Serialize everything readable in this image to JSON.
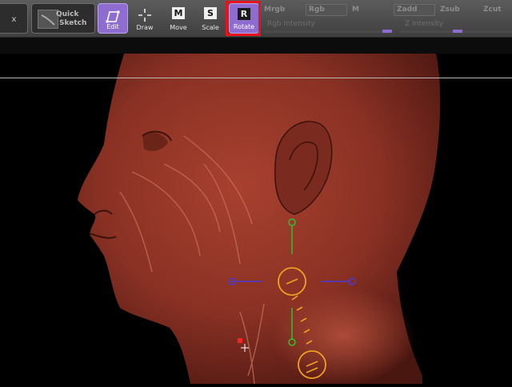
{
  "toolbar": {
    "close_label": "x",
    "quick_sketch": {
      "line1": "Quick",
      "line2": "Sketch"
    },
    "edit_label": "Edit",
    "draw_label": "Draw",
    "move_label": "Move",
    "move_letter": "M",
    "scale_label": "Scale",
    "scale_letter": "S",
    "rotate_label": "Rotate",
    "rotate_letter": "R"
  },
  "right_panel": {
    "mrgb_label": "Mrgb",
    "rgb_label": "Rgb",
    "m_label": "M",
    "zadd_label": "Zadd",
    "zsub_label": "Zsub",
    "zcut_label": "Zcut",
    "rgb_intensity_label": "Rgb Intensity",
    "z_intensity_label": "Z Intensity"
  },
  "colors": {
    "accent": "#8f6ccf",
    "highlight": "#e8141b",
    "gizmo_green": "#2fbf2f",
    "gizmo_orange": "#f0a020",
    "gizmo_blue": "#4b3bd6",
    "model": "#8a3124"
  },
  "icons": [
    "edit-icon",
    "draw-icon",
    "move-icon",
    "scale-icon",
    "rotate-icon",
    "quick-sketch-icon"
  ]
}
